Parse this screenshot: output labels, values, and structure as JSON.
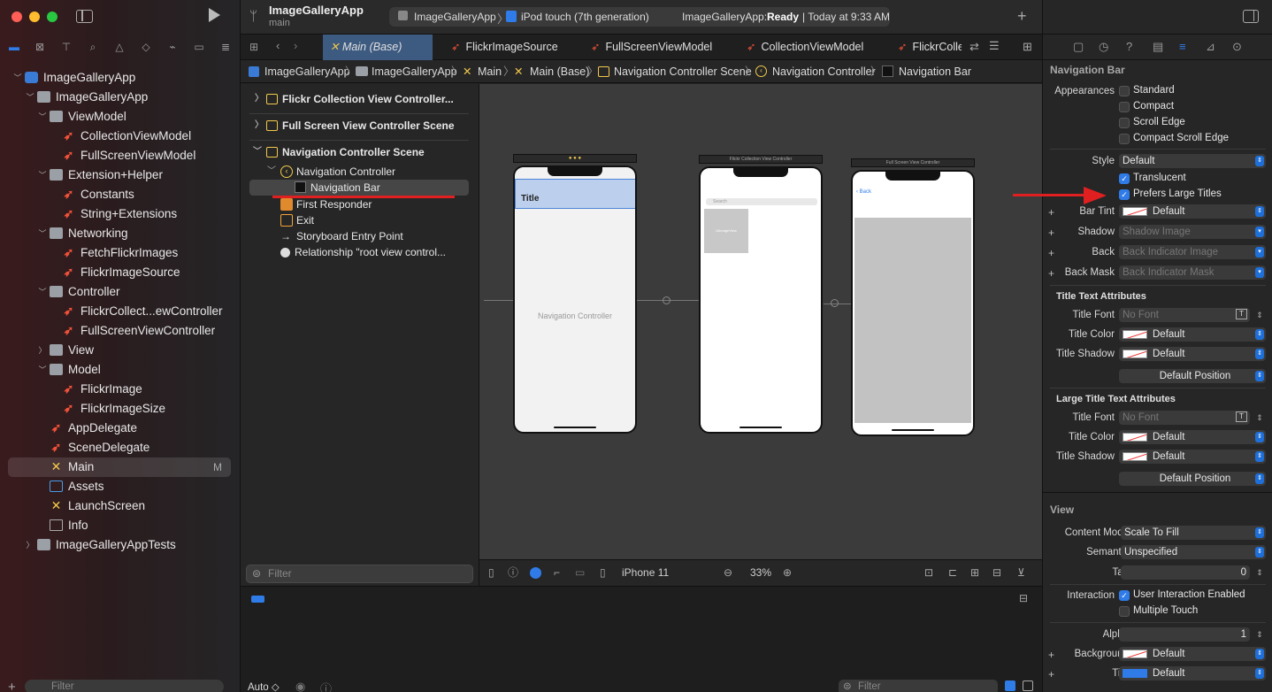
{
  "window": {
    "project_title": "ImageGalleryApp",
    "branch": "main"
  },
  "toolbar": {
    "scheme": "ImageGalleryApp",
    "device": "iPod touch (7th generation)",
    "status_app": "ImageGalleryApp:",
    "status_ready": "Ready",
    "status_time": "| Today at 9:33 AM"
  },
  "navigator": {
    "items": [
      {
        "label": "ImageGalleryApp",
        "kind": "project",
        "indent": 0,
        "open": true
      },
      {
        "label": "ImageGalleryApp",
        "kind": "folder",
        "indent": 1,
        "open": true
      },
      {
        "label": "ViewModel",
        "kind": "folder",
        "indent": 2,
        "open": true
      },
      {
        "label": "CollectionViewModel",
        "kind": "swift",
        "indent": 3
      },
      {
        "label": "FullScreenViewModel",
        "kind": "swift",
        "indent": 3
      },
      {
        "label": "Extension+Helper",
        "kind": "folder",
        "indent": 2,
        "open": true
      },
      {
        "label": "Constants",
        "kind": "swift",
        "indent": 3
      },
      {
        "label": "String+Extensions",
        "kind": "swift",
        "indent": 3
      },
      {
        "label": "Networking",
        "kind": "folder",
        "indent": 2,
        "open": true
      },
      {
        "label": "FetchFlickrImages",
        "kind": "swift",
        "indent": 3
      },
      {
        "label": "FlickrImageSource",
        "kind": "swift",
        "indent": 3
      },
      {
        "label": "Controller",
        "kind": "folder",
        "indent": 2,
        "open": true
      },
      {
        "label": "FlickrCollect...ewController",
        "kind": "swift",
        "indent": 3
      },
      {
        "label": "FullScreenViewController",
        "kind": "swift",
        "indent": 3
      },
      {
        "label": "View",
        "kind": "folder",
        "indent": 2,
        "open": false
      },
      {
        "label": "Model",
        "kind": "folder",
        "indent": 2,
        "open": true
      },
      {
        "label": "FlickrImage",
        "kind": "swift",
        "indent": 3
      },
      {
        "label": "FlickrImageSize",
        "kind": "swift",
        "indent": 3
      },
      {
        "label": "AppDelegate",
        "kind": "swift",
        "indent": 2
      },
      {
        "label": "SceneDelegate",
        "kind": "swift",
        "indent": 2
      },
      {
        "label": "Main",
        "kind": "xib",
        "indent": 2,
        "badge": "M",
        "selected": true
      },
      {
        "label": "Assets",
        "kind": "assets",
        "indent": 2
      },
      {
        "label": "LaunchScreen",
        "kind": "xib",
        "indent": 2
      },
      {
        "label": "Info",
        "kind": "plist",
        "indent": 2
      },
      {
        "label": "ImageGalleryAppTests",
        "kind": "folder",
        "indent": 1,
        "open": false
      }
    ],
    "filter_placeholder": "Filter"
  },
  "tabs": [
    "Main (Base)",
    "FlickrImageSource",
    "FullScreenViewModel",
    "CollectionViewModel",
    "FlickrColle"
  ],
  "jumpbar": [
    "ImageGalleryApp",
    "ImageGalleryApp",
    "Main",
    "Main (Base)",
    "Navigation Controller Scene",
    "Navigation Controller",
    "Navigation Bar"
  ],
  "outline": {
    "scene1": "Flickr Collection View Controller...",
    "scene2": "Full Screen View Controller Scene",
    "scene3": "Navigation Controller Scene",
    "nav_controller": "Navigation Controller",
    "nav_bar": "Navigation Bar",
    "first_responder": "First Responder",
    "exit": "Exit",
    "entry_point": "Storyboard Entry Point",
    "relationship": "Relationship \"root view control...",
    "filter_placeholder": "Filter"
  },
  "canvas": {
    "nav_title": "Title",
    "nav_controller_label": "Navigation Controller",
    "flickr_scene_title": "Flickr Collection View Controller",
    "fullscreen_scene_title": "Full Screen View Controller",
    "search_placeholder": "Search",
    "cell_label": "UIImageView",
    "back_label": "Back",
    "device": "iPhone 11",
    "zoom": "33%"
  },
  "console": {
    "auto_label": "Auto ◇",
    "filter_placeholder": "Filter"
  },
  "inspector": {
    "section_nav_bar": "Navigation Bar",
    "appearances_label": "Appearances",
    "appearances": [
      "Standard",
      "Compact",
      "Scroll Edge",
      "Compact Scroll Edge"
    ],
    "style_label": "Style",
    "style_value": "Default",
    "translucent": "Translucent",
    "prefers_large": "Prefers Large Titles",
    "bar_tint_label": "Bar Tint",
    "bar_tint_value": "Default",
    "shadow_label": "Shadow",
    "shadow_placeholder": "Shadow Image",
    "back_label": "Back",
    "back_placeholder": "Back Indicator Image",
    "back_mask_label": "Back Mask",
    "back_mask_placeholder": "Back Indicator Mask",
    "title_attr_head": "Title Text Attributes",
    "title_font_label": "Title Font",
    "title_font_placeholder": "No Font",
    "title_color_label": "Title Color",
    "title_color_value": "Default",
    "title_shadow_label": "Title Shadow",
    "title_shadow_value": "Default",
    "title_pos_value": "Default Position",
    "large_attr_head": "Large Title Text Attributes",
    "large_font_label": "Title Font",
    "large_font_placeholder": "No Font",
    "large_color_label": "Title Color",
    "large_color_value": "Default",
    "large_shadow_label": "Title Shadow",
    "large_shadow_value": "Default",
    "large_pos_value": "Default Position",
    "section_view": "View",
    "content_mode_label": "Content Mode",
    "content_mode_value": "Scale To Fill",
    "semantic_label": "Semantic",
    "semantic_value": "Unspecified",
    "tag_label": "Tag",
    "tag_value": "0",
    "interaction_label": "Interaction",
    "interaction_enabled": "User Interaction Enabled",
    "multiple_touch": "Multiple Touch",
    "alpha_label": "Alpha",
    "alpha_value": "1",
    "background_label": "Background",
    "background_value": "Default",
    "tint_label": "Tint",
    "tint_value": "Default"
  },
  "colors": {
    "accent": "#2f7be8",
    "annotation_red": "#e02020",
    "selection": "#3d5a80"
  }
}
